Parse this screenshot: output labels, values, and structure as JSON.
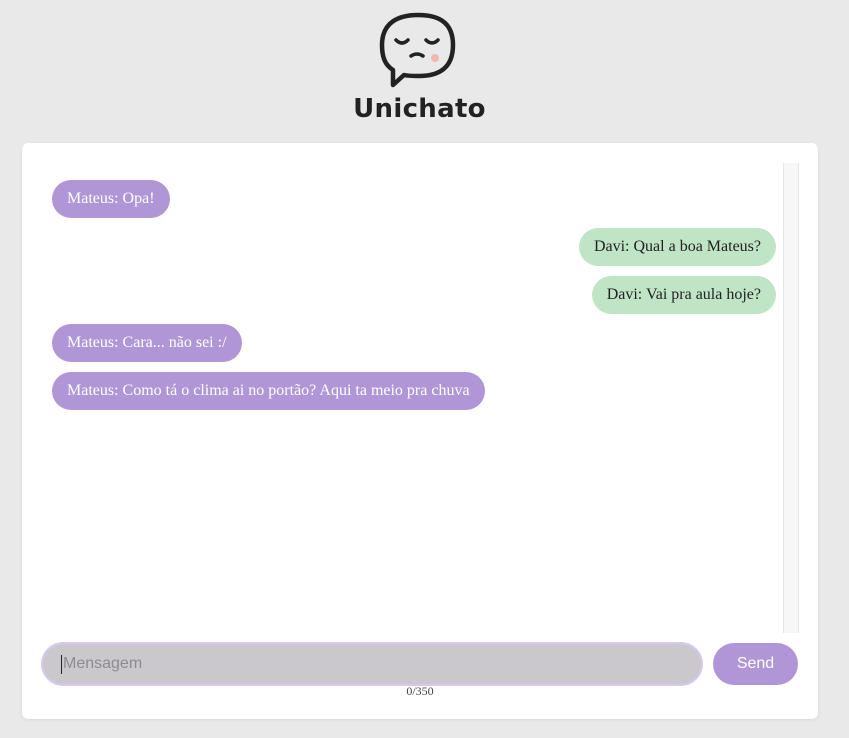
{
  "app": {
    "title": "Unichato",
    "logo_icon": "sleepy-speech-bubble-icon"
  },
  "messages": [
    {
      "sender": "Mateus",
      "text": "Mateus: Opa!",
      "direction": "received"
    },
    {
      "sender": "Davi",
      "text": "Davi: Qual a boa Mateus?",
      "direction": "sent"
    },
    {
      "sender": "Davi",
      "text": "Davi: Vai pra aula hoje?",
      "direction": "sent"
    },
    {
      "sender": "Mateus",
      "text": "Mateus: Cara... não sei :/",
      "direction": "received"
    },
    {
      "sender": "Mateus",
      "text": "Mateus: Como tá o clima ai no portão? Aqui ta meio pra chuva",
      "direction": "received"
    }
  ],
  "composer": {
    "placeholder": "Mensagem",
    "value": "",
    "send_label": "Send",
    "counter": "0/350"
  },
  "colors": {
    "received_bubble": "#b096d7",
    "sent_bubble": "#c0e5c6",
    "accent": "#b096d7",
    "background": "#e9e9e9"
  }
}
